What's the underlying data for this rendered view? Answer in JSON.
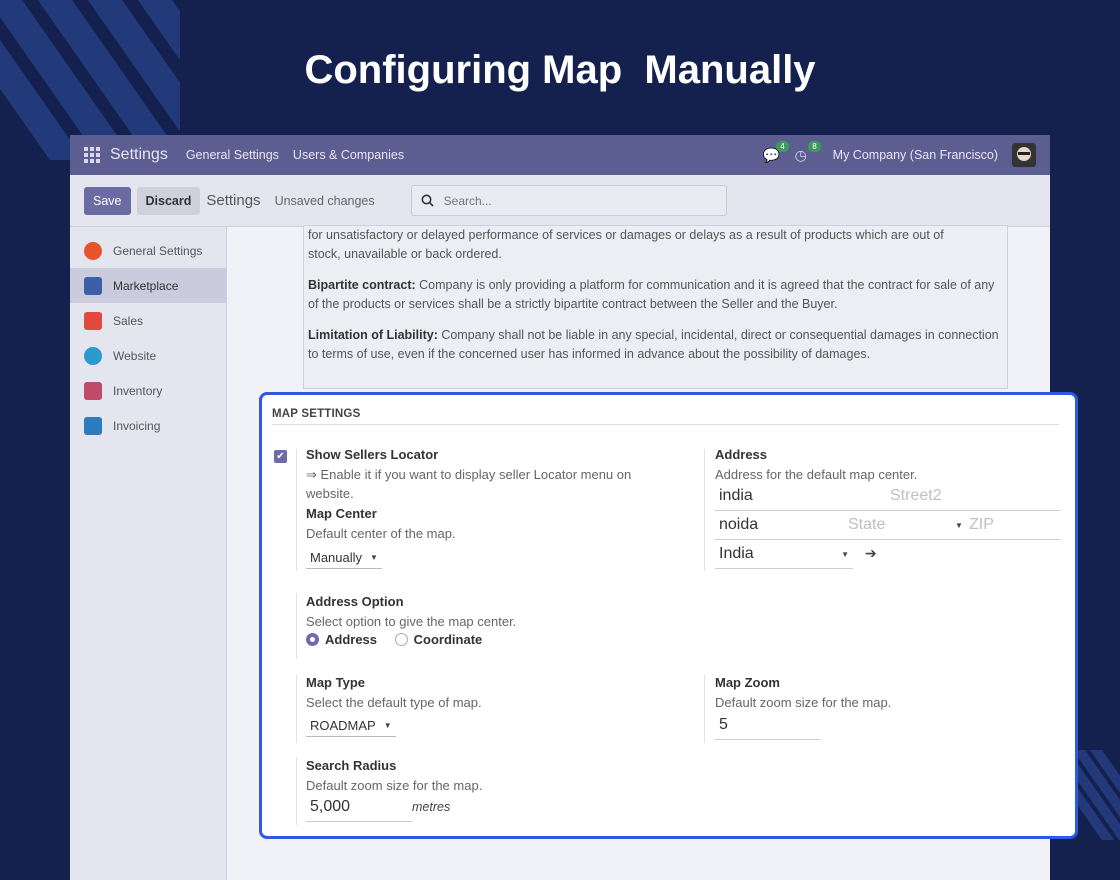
{
  "slide_title": "Configuring Map  Manually",
  "navbar": {
    "app_name": "Settings",
    "menu": [
      "General Settings",
      "Users & Companies"
    ],
    "messages_count": "4",
    "activities_count": "8",
    "company": "My Company (San Francisco)"
  },
  "control_panel": {
    "save": "Save",
    "discard": "Discard",
    "breadcrumb": "Settings",
    "status": "Unsaved changes",
    "search_placeholder": "Search..."
  },
  "sidebar": {
    "items": [
      {
        "label": "General Settings",
        "color": "#e6542d"
      },
      {
        "label": "Marketplace",
        "color": "#3c5fa8"
      },
      {
        "label": "Sales",
        "color": "#e0493b"
      },
      {
        "label": "Website",
        "color": "#2a9ad1"
      },
      {
        "label": "Inventory",
        "color": "#c04a6a"
      },
      {
        "label": "Invoicing",
        "color": "#2c7bbf"
      }
    ]
  },
  "policy_text": {
    "line1": "for unsatisfactory or delayed performance of services or damages or delays as a result of products which are out of",
    "line2": "stock, unavailable or back ordered.",
    "bipartite_title": "Bipartite contract:",
    "bipartite_body": " Company is only providing a platform for communication and it is agreed that the contract for sale of any of the products or services shall be a strictly bipartite contract between the Seller and the Buyer.",
    "liability_title": "Limitation of Liability:",
    "liability_body": " Company shall not be liable in any special, incidental, direct or consequential damages in connection to terms of use, even if the concerned user has informed in advance about the possibility of damages."
  },
  "map_settings": {
    "header": "MAP SETTINGS",
    "show_sellers_locator": {
      "label": "Show Sellers Locator",
      "desc": "⇒ Enable it if you want to display seller Locator menu on website.",
      "checked": true
    },
    "map_center": {
      "label": "Map Center",
      "desc": "Default center of the map.",
      "value": "Manually"
    },
    "address": {
      "label": "Address",
      "desc": "Address for the default map center.",
      "street": "india",
      "street2_placeholder": "Street2",
      "city": "noida",
      "state_placeholder": "State",
      "zip_placeholder": "ZIP",
      "country": "India"
    },
    "address_option": {
      "label": "Address Option",
      "desc": "Select option to give the map center.",
      "options": [
        "Address",
        "Coordinate"
      ],
      "selected": "Address"
    },
    "map_type": {
      "label": "Map Type",
      "desc": "Select the default type of map.",
      "value": "ROADMAP"
    },
    "map_zoom": {
      "label": "Map Zoom",
      "desc": "Default zoom size for the map.",
      "value": "5"
    },
    "search_radius": {
      "label": "Search Radius",
      "desc": "Default zoom size for the map.",
      "value": "5,000",
      "unit": "metres"
    }
  }
}
